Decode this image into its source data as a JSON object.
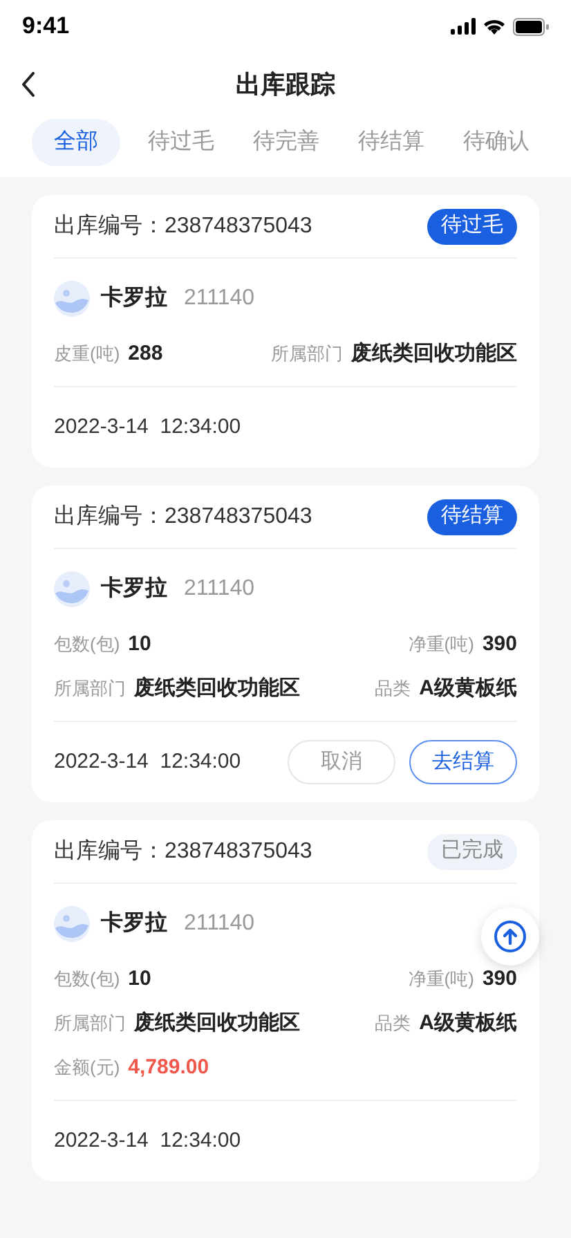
{
  "status_bar": {
    "time": "9:41"
  },
  "nav": {
    "title": "出库跟踪"
  },
  "tabs": [
    {
      "label": "全部",
      "selected": true
    },
    {
      "label": "待过毛",
      "selected": false
    },
    {
      "label": "待完善",
      "selected": false
    },
    {
      "label": "待结算",
      "selected": false
    },
    {
      "label": "待确认",
      "selected": false
    }
  ],
  "cards": [
    {
      "number_label": "出库编号：",
      "number": "238748375043",
      "status": {
        "label": "待过毛",
        "kind": "pending"
      },
      "person": {
        "name": "卡罗拉",
        "code": "211140"
      },
      "rows": [
        [
          {
            "label": "皮重(吨)",
            "value": "288",
            "kind": "plain"
          },
          {
            "label": "所属部门",
            "value": "废纸类回收功能区",
            "kind": "plain"
          }
        ]
      ],
      "time": "2022-3-14  12:34:00"
    },
    {
      "number_label": "出库编号：",
      "number": "238748375043",
      "status": {
        "label": "待结算",
        "kind": "pending"
      },
      "person": {
        "name": "卡罗拉",
        "code": "211140"
      },
      "rows": [
        [
          {
            "label": "包数(包)",
            "value": "10",
            "kind": "plain"
          },
          {
            "label": "净重(吨)",
            "value": "390",
            "kind": "plain"
          }
        ],
        [
          {
            "label": "所属部门",
            "value": "废纸类回收功能区",
            "kind": "plain"
          },
          {
            "label": "品类",
            "value": "A级黄板纸",
            "kind": "plain"
          }
        ]
      ],
      "time": "2022-3-14  12:34:00",
      "actions": [
        {
          "label": "取消",
          "kind": "secondary"
        },
        {
          "label": "去结算",
          "kind": "primary"
        }
      ]
    },
    {
      "number_label": "出库编号：",
      "number": "238748375043",
      "status": {
        "label": "已完成",
        "kind": "done"
      },
      "person": {
        "name": "卡罗拉",
        "code": "211140"
      },
      "rows": [
        [
          {
            "label": "包数(包)",
            "value": "10",
            "kind": "plain"
          },
          {
            "label": "净重(吨)",
            "value": "390",
            "kind": "plain"
          }
        ],
        [
          {
            "label": "所属部门",
            "value": "废纸类回收功能区",
            "kind": "plain"
          },
          {
            "label": "品类",
            "value": "A级黄板纸",
            "kind": "plain"
          }
        ],
        [
          {
            "label": "金额(元)",
            "value": "4,789.00",
            "kind": "amount"
          }
        ]
      ],
      "time": "2022-3-14  12:34:00"
    }
  ]
}
